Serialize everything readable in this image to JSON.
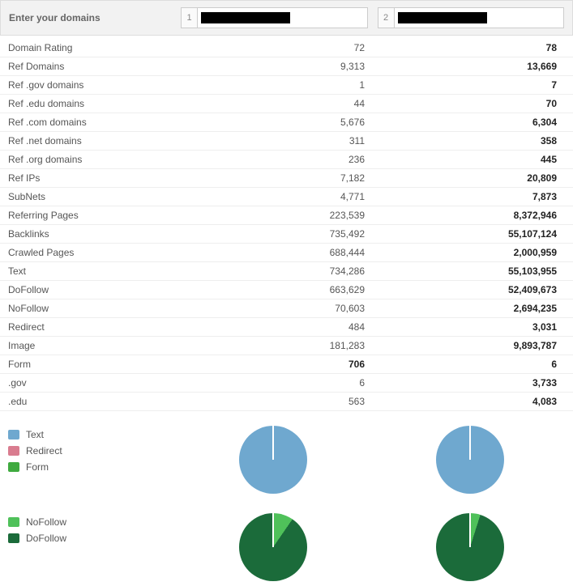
{
  "header": {
    "prompt": "Enter your domains",
    "inputs": [
      {
        "num": "1",
        "value": ""
      },
      {
        "num": "2",
        "value": ""
      }
    ]
  },
  "metrics": [
    {
      "label": "Domain Rating",
      "v1": "72",
      "v2": "78"
    },
    {
      "label": "Ref Domains",
      "v1": "9,313",
      "v2": "13,669"
    },
    {
      "label": "Ref .gov domains",
      "v1": "1",
      "v2": "7"
    },
    {
      "label": "Ref .edu domains",
      "v1": "44",
      "v2": "70"
    },
    {
      "label": "Ref .com domains",
      "v1": "5,676",
      "v2": "6,304"
    },
    {
      "label": "Ref .net domains",
      "v1": "311",
      "v2": "358"
    },
    {
      "label": "Ref .org domains",
      "v1": "236",
      "v2": "445"
    },
    {
      "label": "Ref IPs",
      "v1": "7,182",
      "v2": "20,809"
    },
    {
      "label": "SubNets",
      "v1": "4,771",
      "v2": "7,873"
    },
    {
      "label": "Referring Pages",
      "v1": "223,539",
      "v2": "8,372,946"
    },
    {
      "label": "Backlinks",
      "v1": "735,492",
      "v2": "55,107,124"
    },
    {
      "label": "Crawled Pages",
      "v1": "688,444",
      "v2": "2,000,959"
    },
    {
      "label": "Text",
      "v1": "734,286",
      "v2": "55,103,955"
    },
    {
      "label": "DoFollow",
      "v1": "663,629",
      "v2": "52,409,673"
    },
    {
      "label": "NoFollow",
      "v1": "70,603",
      "v2": "2,694,235"
    },
    {
      "label": "Redirect",
      "v1": "484",
      "v2": "3,031"
    },
    {
      "label": "Image",
      "v1": "181,283",
      "v2": "9,893,787"
    },
    {
      "label": "Form",
      "v1": "706",
      "v2": "6",
      "v1bold": true
    },
    {
      "label": ".gov",
      "v1": "6",
      "v2": "3,733"
    },
    {
      "label": ".edu",
      "v1": "563",
      "v2": "4,083"
    }
  ],
  "colors": {
    "text": "#6fa8cf",
    "redirect": "#d97c8f",
    "form": "#3faa3f",
    "nofollow": "#4fc15a",
    "dofollow": "#1b6b3a"
  },
  "chart_data": [
    {
      "type": "pie",
      "title": "Link Type – Domain 1",
      "series": [
        {
          "name": "Text",
          "value": 734286
        },
        {
          "name": "Redirect",
          "value": 484
        },
        {
          "name": "Form",
          "value": 706
        }
      ]
    },
    {
      "type": "pie",
      "title": "Link Type – Domain 2",
      "series": [
        {
          "name": "Text",
          "value": 55103955
        },
        {
          "name": "Redirect",
          "value": 3031
        },
        {
          "name": "Form",
          "value": 6
        }
      ]
    },
    {
      "type": "pie",
      "title": "Follow – Domain 1",
      "series": [
        {
          "name": "NoFollow",
          "value": 70603
        },
        {
          "name": "DoFollow",
          "value": 663629
        }
      ]
    },
    {
      "type": "pie",
      "title": "Follow – Domain 2",
      "series": [
        {
          "name": "NoFollow",
          "value": 2694235
        },
        {
          "name": "DoFollow",
          "value": 52409673
        }
      ]
    }
  ],
  "legend_linktype": [
    {
      "label": "Text",
      "colorKey": "text"
    },
    {
      "label": "Redirect",
      "colorKey": "redirect"
    },
    {
      "label": "Form",
      "colorKey": "form"
    }
  ],
  "legend_follow": [
    {
      "label": "NoFollow",
      "colorKey": "nofollow"
    },
    {
      "label": "DoFollow",
      "colorKey": "dofollow"
    }
  ]
}
